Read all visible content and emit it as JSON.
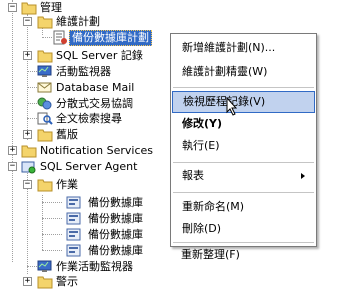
{
  "tree": {
    "management": "管理",
    "maintenance_plans": "維護計劃",
    "backup_plan": "備份數據庫計劃",
    "sql_server_logs": "SQL Server 記錄",
    "activity_monitor": "活動監視器",
    "database_mail": "Database Mail",
    "dtc": "分散式交易協調",
    "fulltext": "全文檢索搜尋",
    "legacy": "舊版",
    "notification_services": "Notification Services",
    "sql_agent": "SQL Server Agent",
    "jobs": "作業",
    "job_items": [
      "備份數據庫",
      "備份數據庫",
      "備份數據庫",
      "備份數據庫"
    ],
    "job_activity_monitor": "作業活動監視器",
    "alerts": "警示"
  },
  "context_menu": {
    "new_plan": "新增維護計劃(N)...",
    "plan_wizard": "維護計劃精靈(W)",
    "view_history": "檢視歷程記錄(V)",
    "modify": "修改(Y)",
    "execute": "執行(E)",
    "reports": "報表",
    "rename": "重新命名(M)",
    "delete": "刪除(D)",
    "refresh": "重新整理(F)"
  }
}
